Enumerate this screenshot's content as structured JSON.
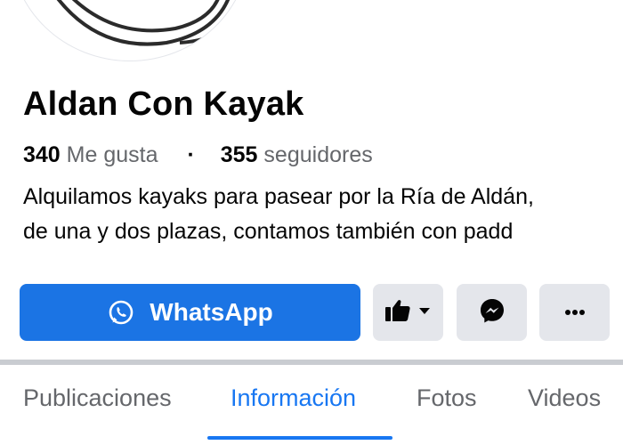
{
  "page": {
    "title": "Aldan Con Kayak",
    "likes_count": "340",
    "likes_label": "Me gusta",
    "separator": "·",
    "followers_count": "355",
    "followers_label": "seguidores",
    "description_line1": "Alquilamos kayaks para pasear por la Ría de Aldán,",
    "description_line2": "de una y dos plazas, contamos también con padd"
  },
  "actions": {
    "whatsapp_label": "WhatsApp",
    "whatsapp_icon": "whatsapp-icon",
    "like_icon": "thumbs-up-icon",
    "messenger_icon": "messenger-icon",
    "more_icon": "more-dots-icon"
  },
  "tabs": [
    {
      "label": "Publicaciones",
      "active": false
    },
    {
      "label": "Información",
      "active": true
    },
    {
      "label": "Fotos",
      "active": false
    },
    {
      "label": "Videos",
      "active": false
    }
  ],
  "colors": {
    "primary": "#1b74e4",
    "accent_text": "#1877f2",
    "secondary_button": "#e4e6eb",
    "muted_text": "#65676b"
  }
}
